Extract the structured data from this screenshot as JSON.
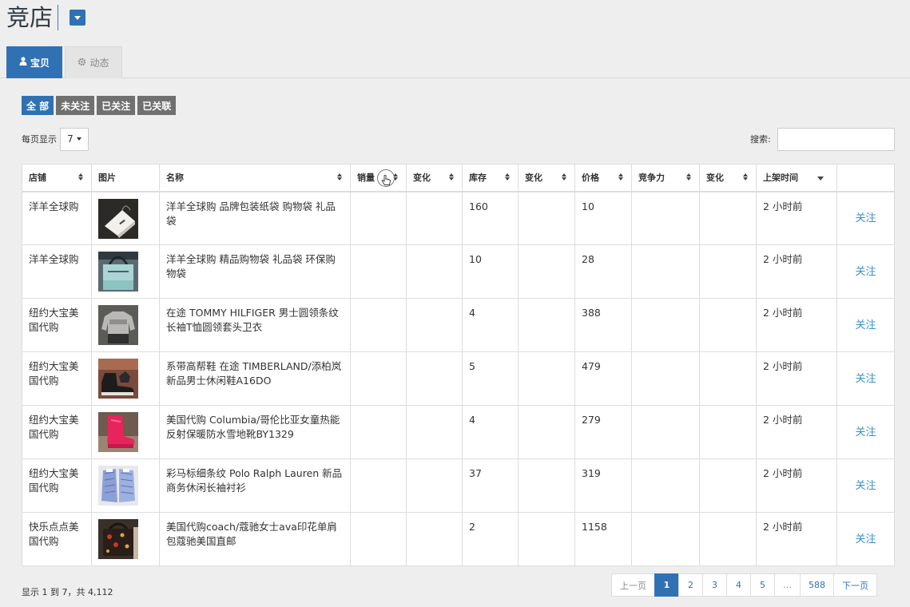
{
  "header": {
    "title": "竞店"
  },
  "tabs": [
    {
      "label": "宝贝",
      "icon": "user-icon",
      "active": true
    },
    {
      "label": "动态",
      "icon": "gear-icon",
      "active": false
    }
  ],
  "filters": [
    {
      "label": "全 部",
      "active": true
    },
    {
      "label": "未关注",
      "active": false
    },
    {
      "label": "已关注",
      "active": false
    },
    {
      "label": "已关联",
      "active": false
    }
  ],
  "page_size": {
    "label": "每页显示",
    "value": "7"
  },
  "search": {
    "label": "搜索:",
    "value": ""
  },
  "table": {
    "columns": [
      "店铺",
      "图片",
      "名称",
      "销量",
      "变化",
      "库存",
      "变化",
      "价格",
      "竞争力",
      "变化",
      "上架时间",
      ""
    ],
    "rows": [
      {
        "shop": "洋羊全球购",
        "image": "paper-gift-bag",
        "name": "洋羊全球购 品牌包装纸袋 购物袋 礼品袋",
        "sales": "",
        "sales_change": "",
        "stock": "160",
        "stock_change": "",
        "price": "10",
        "competitiveness": "",
        "comp_change": "",
        "listed": "2 小时前",
        "action": "关注"
      },
      {
        "shop": "洋羊全球购",
        "image": "shopping-bag",
        "name": "洋羊全球购 精品购物袋 礼品袋 环保购物袋",
        "sales": "",
        "sales_change": "",
        "stock": "10",
        "stock_change": "",
        "price": "28",
        "competitiveness": "",
        "comp_change": "",
        "listed": "2 小时前",
        "action": "关注"
      },
      {
        "shop": "纽约大宝美国代购",
        "image": "sweatshirt",
        "name": "在途 TOMMY HILFIGER 男士圆领条纹长袖T恤圆领套头卫衣",
        "sales": "",
        "sales_change": "",
        "stock": "4",
        "stock_change": "",
        "price": "388",
        "competitiveness": "",
        "comp_change": "",
        "listed": "2 小时前",
        "action": "关注"
      },
      {
        "shop": "纽约大宝美国代购",
        "image": "boots",
        "name": "系带高帮鞋 在途 TIMBERLAND/添柏岚 新品男士休闲鞋A16DO",
        "sales": "",
        "sales_change": "",
        "stock": "5",
        "stock_change": "",
        "price": "479",
        "competitiveness": "",
        "comp_change": "",
        "listed": "2 小时前",
        "action": "关注"
      },
      {
        "shop": "纽约大宝美国代购",
        "image": "pink-snow-boots",
        "name": "美国代购 Columbia/哥伦比亚女童热能反射保暖防水雪地靴BY1329",
        "sales": "",
        "sales_change": "",
        "stock": "4",
        "stock_change": "",
        "price": "279",
        "competitiveness": "",
        "comp_change": "",
        "listed": "2 小时前",
        "action": "关注"
      },
      {
        "shop": "纽约大宝美国代购",
        "image": "striped-shirts",
        "name": "彩马标细条纹 Polo Ralph Lauren 新品商务休闲长袖衬衫",
        "sales": "",
        "sales_change": "",
        "stock": "37",
        "stock_change": "",
        "price": "319",
        "competitiveness": "",
        "comp_change": "",
        "listed": "2 小时前",
        "action": "关注"
      },
      {
        "shop": "快乐点点美国代购",
        "image": "coach-bag",
        "name": "美国代购coach/蔻驰女士ava印花单肩包蔻驰美国直邮",
        "sales": "",
        "sales_change": "",
        "stock": "2",
        "stock_change": "",
        "price": "1158",
        "competitiveness": "",
        "comp_change": "",
        "listed": "2 小时前",
        "action": "关注"
      }
    ]
  },
  "footer": {
    "info": "显示 1 到 7，共 4,112"
  },
  "pagination": {
    "prev": "上一页",
    "pages": [
      "1",
      "2",
      "3",
      "4",
      "5",
      "…",
      "588"
    ],
    "current": "1",
    "next": "下一页"
  },
  "colors": {
    "primary": "#3071b3",
    "link": "#3a8fc9",
    "gray_button": "#707070",
    "background": "#eeeeee"
  }
}
